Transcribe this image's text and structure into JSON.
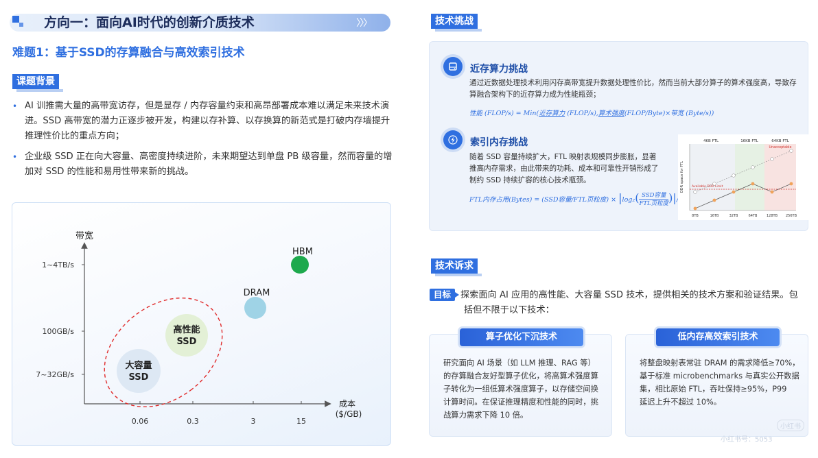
{
  "header": {
    "main_title": "方向一：面向AI时代的创新介质技术",
    "chevrons": "〉〉〉",
    "sub_title": "难题1：基于SSD的存算融合与高效索引技术"
  },
  "background": {
    "tag": "课题背景",
    "bullets": [
      "AI 训推需大量的高带宽访存，但是显存 / 内存容量约束和高昂部署成本难以满足未来技术演进。SSD 高带宽的潜力正逐步被开发，构建以存补算、以存换算的新范式是打破内存墙提升推理性价比的重点方向；",
      "企业级 SSD 正在向大容量、高密度持续进阶，未来期望达到单盘 PB 级容量，然而容量的增加对 SSD 的性能和易用性带来新的挑战。"
    ]
  },
  "bubble_chart": {
    "y_title": "带宽",
    "x_title_line1": "成本",
    "x_title_line2": "($/GB)",
    "y_ticks": [
      "1~4TB/s",
      "100GB/s",
      "7~32GB/s"
    ],
    "x_ticks": [
      "0.06",
      "0.3",
      "3",
      "15"
    ],
    "bubbles": [
      {
        "label": "HBM",
        "color": "#1ea94d"
      },
      {
        "label": "DRAM",
        "color": "#9fd3e6"
      },
      {
        "label_line1": "高性能",
        "label_line2": "SSD",
        "color": "#e3f0d6"
      },
      {
        "label_line1": "大容量",
        "label_line2": "SSD",
        "color": "#dde8f4"
      }
    ]
  },
  "challenges": {
    "tag": "技术挑战",
    "compute": {
      "icon": "storage-icon",
      "title": "近存算力挑战",
      "text": "通过近数据处理技术利用闪存高带宽提升数据处理性价比，然而当前大部分算子的算术强度高，导致存算融合架构下的近存算力成为性能瓶颈；",
      "formula_a": "性能 (FLOP/s)  =  Min(",
      "formula_u1": "近存算力",
      "formula_b": " (FLOP/s),",
      "formula_u2": "算术强度",
      "formula_c": "(FLOP/Byte)×带宽 (Byte/s))"
    },
    "index": {
      "icon": "lightning-icon",
      "title": "索引内存挑战",
      "text": "随着 SSD 容量持续扩大，FTL 映射表规模同步膨胀，显著推高内存需求，由此带来的功耗、成本和可靠性开销形成了制约 SSD 持续扩容的核心技术瓶颈。",
      "formula_a": "FTL内存占用(Bytes) = (SSD容量/FTL页粒度) ×",
      "formula_log": "log₂",
      "formula_num": "SSD容量",
      "formula_den": "FTL页粒度",
      "formula_end": "/8"
    },
    "mini_chart": {
      "zones": [
        "4KB  FTL",
        "16KB  FTL",
        "64KB  FTL"
      ],
      "unacceptable": "Unacceptable",
      "limit_label": "Available DDR Limit",
      "y_label": "DDR space for FTL",
      "x_ticks": [
        "8TB",
        "16TB",
        "32TB",
        "64TB",
        "128TB",
        "256TB"
      ],
      "series_orange": [
        1,
        2,
        3,
        4,
        3,
        4
      ],
      "series_gray": [
        3,
        4,
        5,
        6,
        7,
        8
      ]
    }
  },
  "requirements": {
    "tag": "技术诉求",
    "goal_badge": "目标",
    "goal_line1": "探索面向 AI 应用的高性能、大容量 SSD 技术，提供相关的技术方案和验证结果。包",
    "goal_line2": "括但不限于以下技术：",
    "boxes": [
      {
        "title": "算子优化下沉技术",
        "lines": [
          "研究面向 AI 场景（如 LLM 推理、RAG 等）",
          "的存算融合友好型算子优化，将高算术强度算",
          "子转化为一组低算术强度算子，以存储空间换",
          "计算时间。在保证推理精度和性能的同时，挑",
          "战算力需求下降 10 倍。"
        ]
      },
      {
        "title": "低内存高效索引技术",
        "lines": [
          "将整盘映射表常驻 DRAM 的需求降低≥70%，",
          "基于标准 microbenchmarks 与真实公开数据",
          "集，相比原始 FTL，吞吐保持≥95%，P99",
          "延迟上升不超过 10%。"
        ]
      }
    ]
  },
  "watermark": {
    "badge": "小红书",
    "id": "小红书号：5053"
  }
}
